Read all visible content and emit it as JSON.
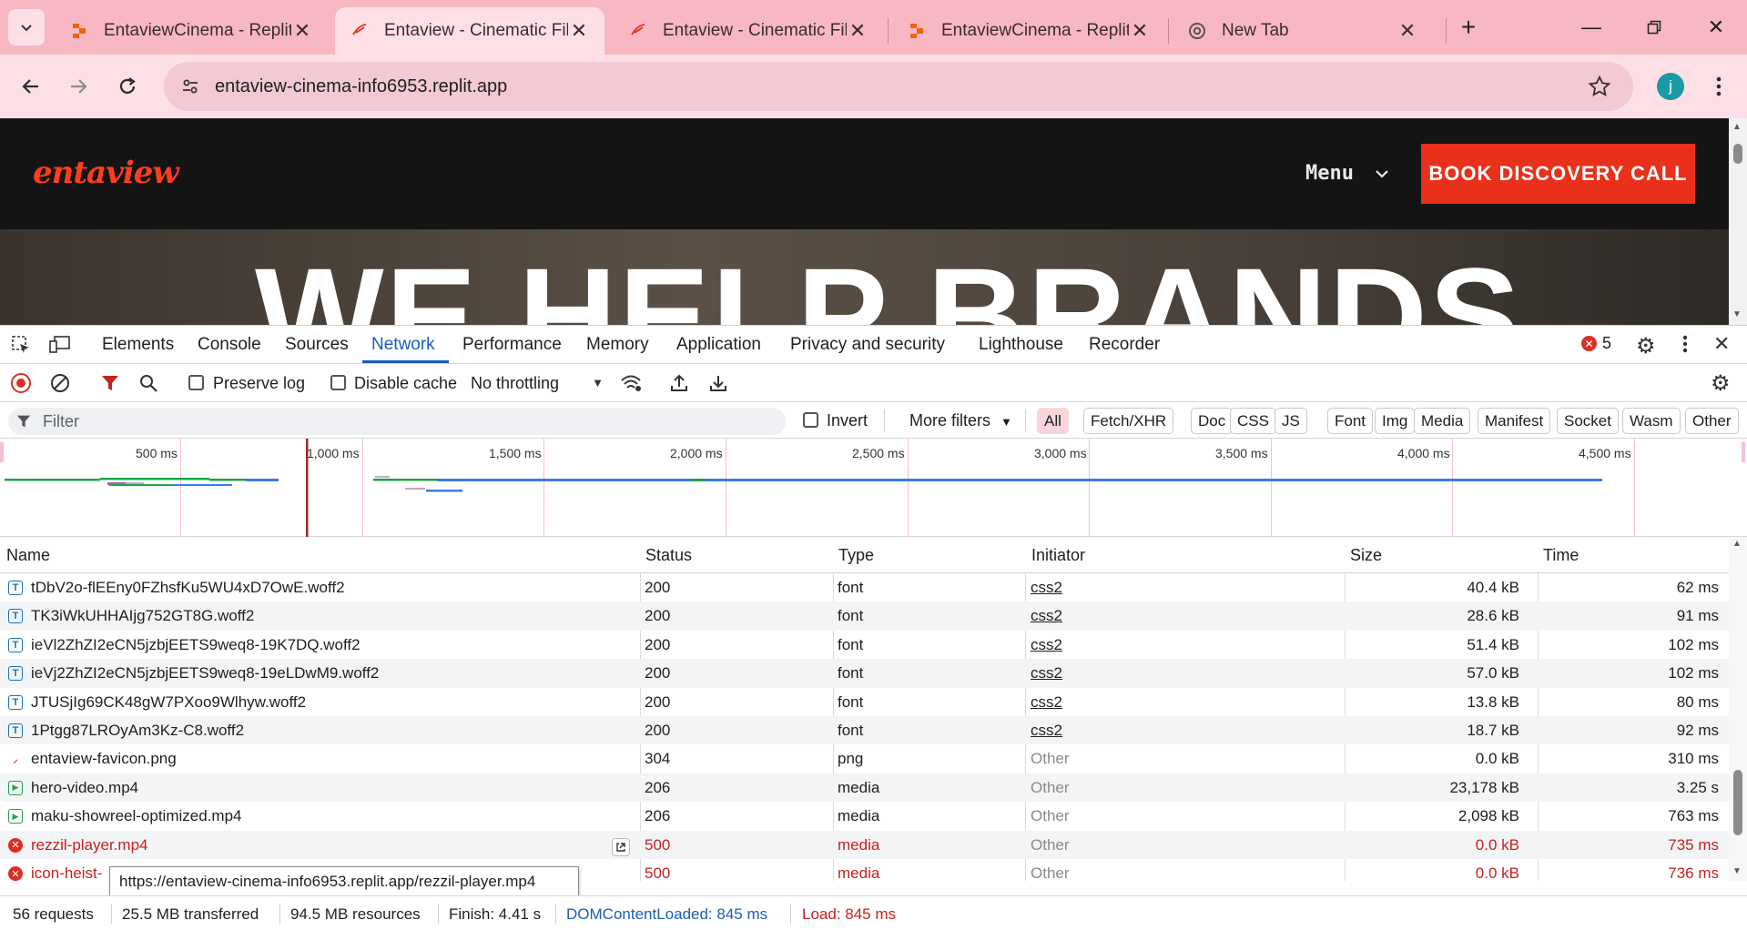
{
  "browser": {
    "tabs": [
      {
        "title": "EntaviewCinema - Replit",
        "icon": "replit-icon"
      },
      {
        "title": "Entaview - Cinematic Film",
        "icon": "entaview-icon",
        "active": true
      },
      {
        "title": "Entaview - Cinematic Film",
        "icon": "entaview-icon"
      },
      {
        "title": "EntaviewCinema - Replit",
        "icon": "replit-icon"
      },
      {
        "title": "New Tab",
        "icon": "chrome-icon"
      }
    ],
    "url": "entaview-cinema-info6953.replit.app",
    "profile_initial": "j"
  },
  "site": {
    "logo": "entaview",
    "menu_label": "Menu",
    "cta_label": "BOOK DISCOVERY CALL",
    "hero_text": "WE HELP BRANDS"
  },
  "devtools": {
    "tabs": [
      "Elements",
      "Console",
      "Sources",
      "Network",
      "Performance",
      "Memory",
      "Application",
      "Privacy and security",
      "Lighthouse",
      "Recorder"
    ],
    "active_tab": "Network",
    "error_count": "5",
    "toolbar": {
      "preserve_log": "Preserve log",
      "disable_cache": "Disable cache",
      "throttling": "No throttling"
    },
    "filter": {
      "placeholder": "Filter",
      "invert": "Invert",
      "more_filters": "More filters",
      "types": [
        "All",
        "Fetch/XHR",
        "Doc",
        "CSS",
        "JS",
        "Font",
        "Img",
        "Media",
        "Manifest",
        "Socket",
        "Wasm",
        "Other"
      ],
      "active_type": "All"
    },
    "timeline_ticks": [
      "500 ms",
      "1,000 ms",
      "1,500 ms",
      "2,000 ms",
      "2,500 ms",
      "3,000 ms",
      "3,500 ms",
      "4,000 ms",
      "4,500 ms"
    ],
    "columns": [
      "Name",
      "Status",
      "Type",
      "Initiator",
      "Size",
      "Time"
    ],
    "rows": [
      {
        "name": "tDbV2o-flEEny0FZhsfKu5WU4xD7OwE.woff2",
        "status": "200",
        "type": "font",
        "initiator": "css2",
        "size": "40.4 kB",
        "time": "62 ms",
        "kind": "font"
      },
      {
        "name": "TK3iWkUHHAIjg752GT8G.woff2",
        "status": "200",
        "type": "font",
        "initiator": "css2",
        "size": "28.6 kB",
        "time": "91 ms",
        "kind": "font"
      },
      {
        "name": "ieVl2ZhZI2eCN5jzbjEETS9weq8-19K7DQ.woff2",
        "status": "200",
        "type": "font",
        "initiator": "css2",
        "size": "51.4 kB",
        "time": "102 ms",
        "kind": "font"
      },
      {
        "name": "ieVj2ZhZI2eCN5jzbjEETS9weq8-19eLDwM9.woff2",
        "status": "200",
        "type": "font",
        "initiator": "css2",
        "size": "57.0 kB",
        "time": "102 ms",
        "kind": "font"
      },
      {
        "name": "JTUSjIg69CK48gW7PXoo9Wlhyw.woff2",
        "status": "200",
        "type": "font",
        "initiator": "css2",
        "size": "13.8 kB",
        "time": "80 ms",
        "kind": "font"
      },
      {
        "name": "1Ptgg87LROyAm3Kz-C8.woff2",
        "status": "200",
        "type": "font",
        "initiator": "css2",
        "size": "18.7 kB",
        "time": "92 ms",
        "kind": "font"
      },
      {
        "name": "entaview-favicon.png",
        "status": "304",
        "type": "png",
        "initiator": "Other",
        "size": "0.0 kB",
        "time": "310 ms",
        "kind": "img"
      },
      {
        "name": "hero-video.mp4",
        "status": "206",
        "type": "media",
        "initiator": "Other",
        "size": "23,178 kB",
        "time": "3.25 s",
        "kind": "media"
      },
      {
        "name": "maku-showreel-optimized.mp4",
        "status": "206",
        "type": "media",
        "initiator": "Other",
        "size": "2,098 kB",
        "time": "763 ms",
        "kind": "media"
      },
      {
        "name": "rezzil-player.mp4",
        "status": "500",
        "type": "media",
        "initiator": "Other",
        "size": "0.0 kB",
        "time": "735 ms",
        "kind": "error"
      },
      {
        "name": "icon-heist-",
        "status": "500",
        "type": "media",
        "initiator": "Other",
        "size": "0.0 kB",
        "time": "736 ms",
        "kind": "error"
      }
    ],
    "tooltip": "https://entaview-cinema-info6953.replit.app/rezzil-player.mp4",
    "status": {
      "requests": "56 requests",
      "transferred": "25.5 MB transferred",
      "resources": "94.5 MB resources",
      "finish": "Finish: 4.41 s",
      "dom_loaded": "DOMContentLoaded: 845 ms",
      "load": "Load: 845 ms"
    },
    "colors": {
      "accent": "#1a5fb4",
      "error": "#c5221f",
      "dom": "#1a5fb4",
      "load": "#c5221f"
    }
  }
}
